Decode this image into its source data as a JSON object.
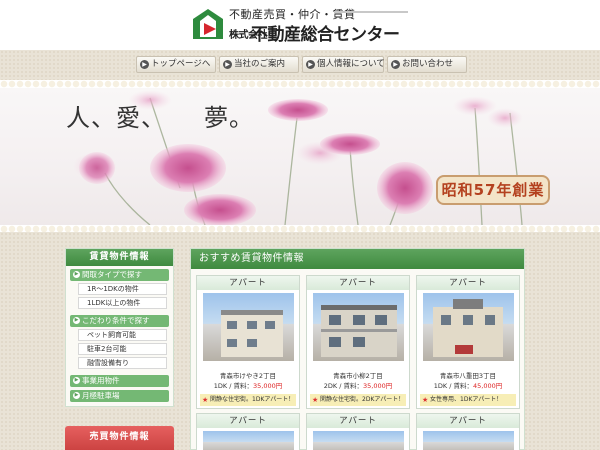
{
  "header": {
    "tagline": "不動産売買・仲介・賃貸",
    "company_prefix": "株式会社",
    "company_name": "不動産総合センター",
    "brand_color": "#2e8b3e",
    "accent_color": "#d6262e"
  },
  "nav": {
    "items": [
      {
        "label": "トップページへ",
        "icon": "arrow-right-icon"
      },
      {
        "label": "当社のご案内",
        "icon": "arrow-right-icon"
      },
      {
        "label": "個人情報について",
        "icon": "arrow-right-icon"
      },
      {
        "label": "お問い合わせ",
        "icon": "arrow-right-icon"
      }
    ]
  },
  "hero": {
    "text": "人、愛、　　夢。",
    "badge": "昭和57年創業"
  },
  "sidebar": {
    "rental_title": "賃貸物件情報",
    "sale_title": "売買物件情報",
    "categories": [
      {
        "label": "間取タイプで探す",
        "subs": [
          "1R～1DKの物件",
          "1LDK以上の物件"
        ]
      },
      {
        "label": "こだわり条件で探す",
        "subs": [
          "ペット飼育可能",
          "駐車2台可能",
          "融雪設備有り"
        ]
      },
      {
        "label": "事業用物件",
        "subs": []
      },
      {
        "label": "月極駐車場",
        "subs": []
      }
    ]
  },
  "main": {
    "title": "おすすめ賃貸物件情報",
    "cards": [
      {
        "type": "アパート",
        "location": "青森市けやき2丁目",
        "layout": "1DK / 賃料：",
        "rent": "35,000円",
        "note": "閑静な住宅街。1DKアパート！"
      },
      {
        "type": "アパート",
        "location": "青森市小柳2丁目",
        "layout": "2DK / 賃料：",
        "rent": "35,000円",
        "note": "閑静な住宅街。2DKアパート！"
      },
      {
        "type": "アパート",
        "location": "青森市八重田3丁目",
        "layout": "1DK / 賃料：",
        "rent": "45,000円",
        "note": "女性専用、1DKアパート！"
      },
      {
        "type": "アパート"
      },
      {
        "type": "アパート"
      },
      {
        "type": "アパート"
      }
    ]
  }
}
